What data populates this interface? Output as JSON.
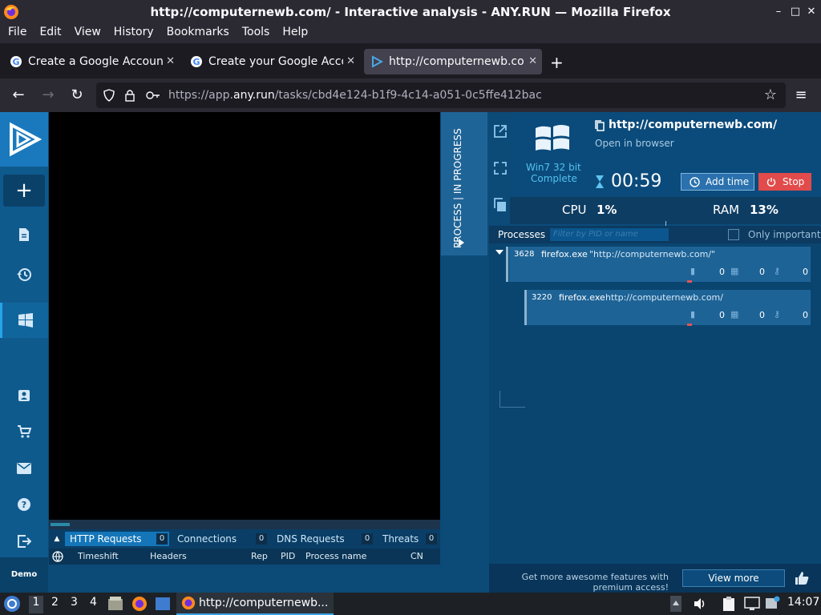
{
  "window": {
    "title": "http://computernewb.com/ - Interactive analysis - ANY.RUN — Mozilla Firefox",
    "minimize": "–",
    "maximize": "□",
    "close": "✕"
  },
  "menu": [
    "File",
    "Edit",
    "View",
    "History",
    "Bookmarks",
    "Tools",
    "Help"
  ],
  "tabs": [
    {
      "label": "Create a Google Account",
      "favicon": "google-icon",
      "active": false
    },
    {
      "label": "Create your Google Account",
      "favicon": "google-icon",
      "active": false
    },
    {
      "label": "http://computernewb.com/",
      "favicon": "anyrun-icon",
      "active": true
    }
  ],
  "tab_close": "✕",
  "new_tab": "+",
  "nav": {
    "url_prefix": "https://app.",
    "url_domain": "any.run",
    "url_path": "/tasks/cbd4e124-b1f9-4c14-a051-0c5ffe412bac"
  },
  "sidebar": {
    "new_task": "+",
    "demo_plan": "Demo plan"
  },
  "vertical_tab": "PROCESS | IN PROGRESS",
  "info": {
    "os_name": "Win7 32 bit",
    "os_status": "Complete",
    "url": "http://computernewb.com/",
    "open_in_browser": "Open in browser",
    "timer": "00:59",
    "add_time": "Add time",
    "stop": "Stop",
    "cpu_label": "CPU",
    "cpu_value": "1%",
    "ram_label": "RAM",
    "ram_value": "13%"
  },
  "processes": {
    "title": "Processes",
    "filter_placeholder": "Filter by PID or name",
    "only_important": "Only important",
    "rows": [
      {
        "pid": "3628",
        "name": "firefox.exe",
        "cmd": "\"http://computernewb.com/\"",
        "files": "0",
        "modules": "0",
        "keys": "0"
      },
      {
        "pid": "3220",
        "name": "firefox.exe",
        "cmd": "http://computernewb.com/",
        "files": "0",
        "modules": "0",
        "keys": "0"
      }
    ]
  },
  "bottom_tabs": [
    {
      "label": "HTTP Requests",
      "count": "0",
      "active": true
    },
    {
      "label": "Connections",
      "count": "0",
      "active": false
    },
    {
      "label": "DNS Requests",
      "count": "0",
      "active": false
    },
    {
      "label": "Threats",
      "count": "0",
      "active": false
    }
  ],
  "bottom_headers": [
    "Timeshift",
    "Headers",
    "Rep",
    "PID",
    "Process name",
    "CN"
  ],
  "footer": {
    "promo": "Get more awesome features with premium access!",
    "view_more": "View more"
  },
  "taskbar": {
    "workspaces": [
      "1",
      "2",
      "3",
      "4"
    ],
    "window_label": "http://computernewb...",
    "clock": "14:07"
  },
  "colors": {
    "accent": "#1476b8",
    "stop": "#e24b4b",
    "app_bg": "#0c4a78"
  }
}
